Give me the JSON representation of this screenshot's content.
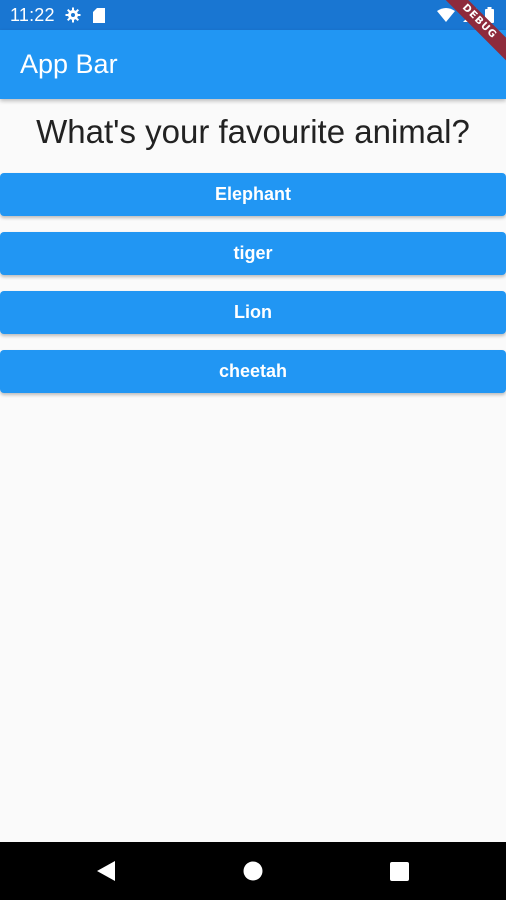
{
  "status_bar": {
    "time": "11:22",
    "icons": [
      "gear-icon",
      "sd-card-icon",
      "wifi-icon",
      "signal-icon",
      "battery-icon"
    ]
  },
  "debug_banner": "DEBUG",
  "app_bar": {
    "title": "App Bar"
  },
  "quiz": {
    "question": "What's your favourite animal?",
    "answers": [
      "Elephant",
      "tiger",
      "Lion",
      "cheetah"
    ]
  },
  "nav_bar": {
    "icons": [
      "back-icon",
      "home-icon",
      "recents-icon"
    ]
  },
  "colors": {
    "status_bar": "#1976d2",
    "primary": "#2196f3",
    "background": "#fafafa",
    "debug_banner": "#8e2b3c",
    "nav_bar": "#000000"
  }
}
